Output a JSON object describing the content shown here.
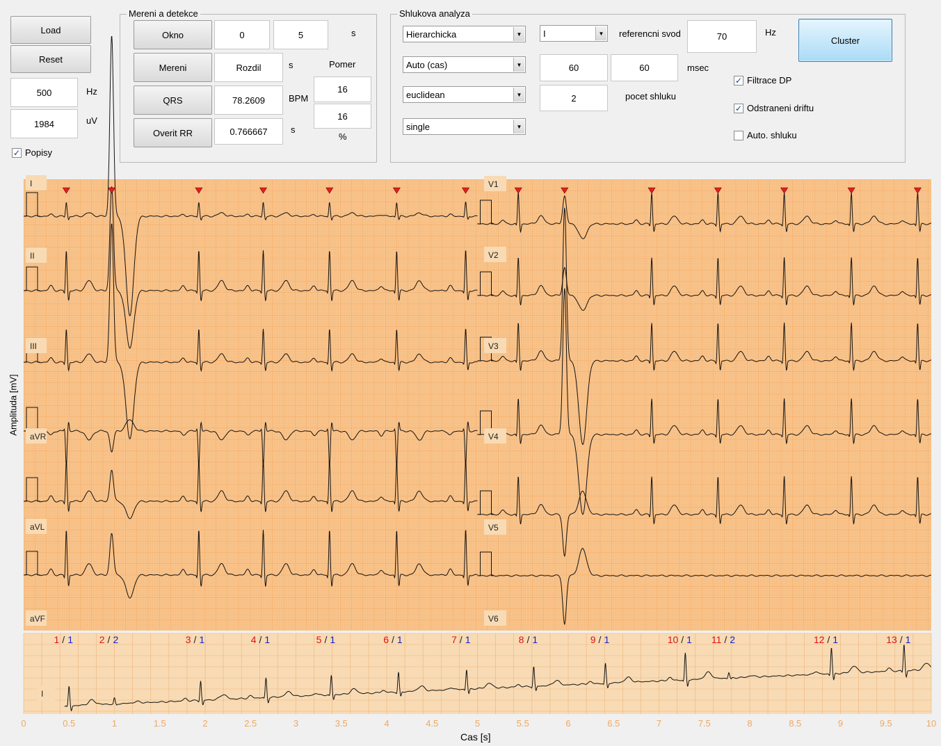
{
  "left_panel": {
    "load_label": "Load",
    "reset_label": "Reset",
    "fs_value": "500",
    "fs_unit": "Hz",
    "gain_value": "1984",
    "gain_unit": "uV",
    "popisy_label": "Popisy",
    "popisy_checked": true
  },
  "mereni": {
    "title": "Mereni a detekce",
    "okno_label": "Okno",
    "okno_from": "0",
    "okno_to": "5",
    "okno_unit": "s",
    "mereni_label": "Mereni",
    "mereni_value": "Rozdil",
    "mereni_unit": "s",
    "pomer_label": "Pomer",
    "pomer_value1": "16",
    "pomer_value2": "16",
    "pomer_unit": "%",
    "qrs_label": "QRS",
    "qrs_value": "78.2609",
    "qrs_unit": "BPM",
    "rr_label": "Overit RR",
    "rr_value": "0.766667",
    "rr_unit": "s"
  },
  "shluk": {
    "title": "Shlukova analyza",
    "method": "Hierarchicka",
    "features": "Auto (cas)",
    "distance": "euclidean",
    "linkage": "single",
    "lead": "I",
    "ref_label": "referencni svod",
    "ref_value": "70",
    "ref_unit": "Hz",
    "win1": "60",
    "win2": "60",
    "win_unit": "msec",
    "clusters_value": "2",
    "clusters_label": "pocet shluku",
    "cluster_button": "Cluster",
    "filtrace_label": "Filtrace DP",
    "filtrace_checked": true,
    "drift_label": "Odstraneni driftu",
    "drift_checked": true,
    "auto_label": "Auto. shluku",
    "auto_checked": false
  },
  "plot": {
    "ylabel": "Amplituda [mV]",
    "xlabel": "Cas [s]",
    "left_leads": [
      "I",
      "II",
      "III",
      "aVR",
      "aVL",
      "aVF"
    ],
    "right_leads": [
      "V1",
      "V2",
      "V3",
      "V4",
      "V5",
      "V6"
    ],
    "x_ticks": [
      "0",
      "0.5",
      "1",
      "1.5",
      "2",
      "2.5",
      "3",
      "3.5",
      "4",
      "4.5",
      "5",
      "5.5",
      "6",
      "6.5",
      "7",
      "7.5",
      "8",
      "8.5",
      "9",
      "9.5",
      "10"
    ],
    "rhythm_lead": "I",
    "grid_color": "#f0ad66",
    "bg_color": "#f8c48c",
    "marker_color": "#e02020"
  },
  "chart_data": {
    "type": "line",
    "xlabel": "Cas [s]",
    "ylabel": "Amplituda [mV]",
    "xlim": [
      0,
      10
    ],
    "beat_labels": [
      {
        "t": 0.5,
        "beat": "1",
        "cluster": "1"
      },
      {
        "t": 1.0,
        "beat": "2",
        "cluster": "2"
      },
      {
        "t": 1.95,
        "beat": "3",
        "cluster": "1"
      },
      {
        "t": 2.67,
        "beat": "4",
        "cluster": "1"
      },
      {
        "t": 3.39,
        "beat": "5",
        "cluster": "1"
      },
      {
        "t": 4.13,
        "beat": "6",
        "cluster": "1"
      },
      {
        "t": 4.88,
        "beat": "7",
        "cluster": "1"
      },
      {
        "t": 5.62,
        "beat": "8",
        "cluster": "1"
      },
      {
        "t": 6.41,
        "beat": "9",
        "cluster": "1"
      },
      {
        "t": 7.29,
        "beat": "10",
        "cluster": "1"
      },
      {
        "t": 7.77,
        "beat": "11",
        "cluster": "2"
      },
      {
        "t": 8.9,
        "beat": "12",
        "cluster": "1"
      },
      {
        "t": 9.7,
        "beat": "13",
        "cluster": "1"
      }
    ],
    "r_peaks_left_s": [
      0.47,
      0.97,
      1.93,
      2.64,
      3.37,
      4.11,
      4.87
    ],
    "r_peaks_right_s": [
      5.45,
      5.96,
      6.92,
      7.65,
      8.38,
      9.12,
      9.85
    ]
  }
}
